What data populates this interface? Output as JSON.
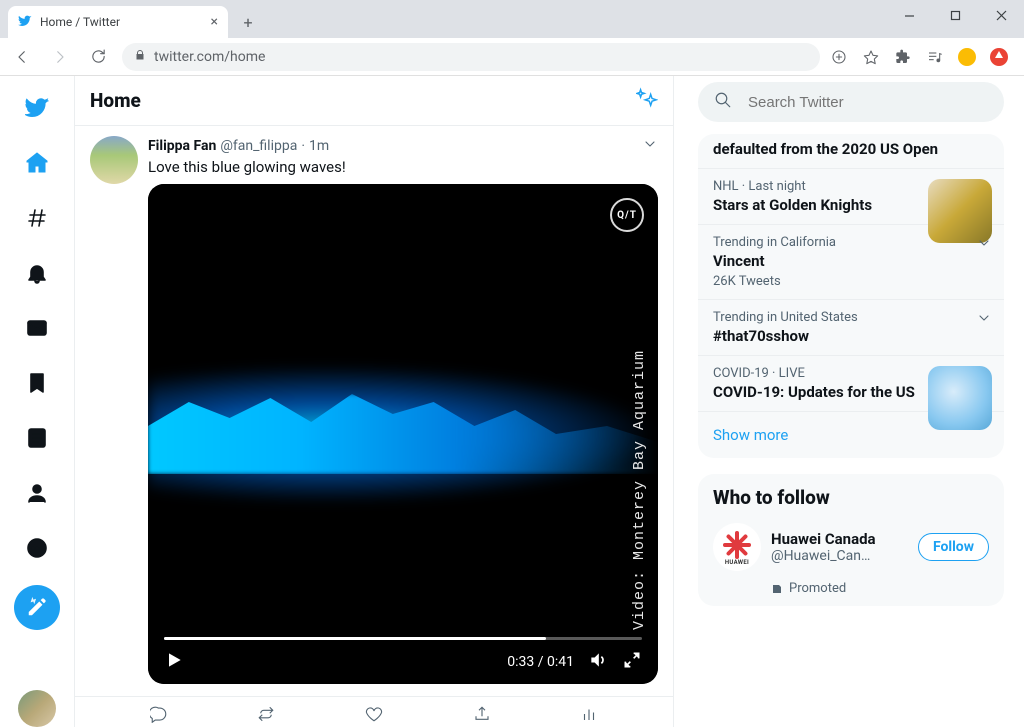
{
  "browser": {
    "tab_title": "Home / Twitter",
    "url": "twitter.com/home"
  },
  "header": {
    "title": "Home"
  },
  "search": {
    "placeholder": "Search Twitter"
  },
  "tweet": {
    "author_name": "Filippa Fan",
    "author_handle": "@fan_filippa",
    "separator": "·",
    "time": "1m",
    "text": "Love this blue glowing waves!",
    "video": {
      "badge": "Q/T",
      "credit": "Video: Monterey Bay Aquarium",
      "current_time": "0:33",
      "duration": "0:41",
      "time_display": "0:33 / 0:41",
      "progress_pct": 80
    }
  },
  "trends": {
    "items": [
      {
        "meta": "",
        "title": "defaulted from the 2020 US Open",
        "has_chevron": false,
        "has_thumb": false
      },
      {
        "meta": "NHL · Last night",
        "title": "Stars at Golden Knights",
        "has_chevron": false,
        "has_thumb": true,
        "thumb_css": "linear-gradient(135deg,#e8dcc0 0%, #c8a838 50%, #887828 100%)"
      },
      {
        "meta": "Trending in California",
        "title": "Vincent",
        "sub": "26K Tweets",
        "has_chevron": true
      },
      {
        "meta": "Trending in United States",
        "title": "#that70sshow",
        "has_chevron": true
      },
      {
        "meta": "COVID-19 · LIVE",
        "title": "COVID-19: Updates for the US",
        "has_chevron": false,
        "has_thumb": true,
        "thumb_css": "radial-gradient(circle at 40% 40%, #d8ecfa 0%, #88c8f0 60%, #58a8d8 100%)"
      }
    ],
    "show_more": "Show more"
  },
  "wtf": {
    "title": "Who to follow",
    "account": {
      "name": "Huawei Canada",
      "handle": "@Huawei_Can…",
      "follow_label": "Follow",
      "brand_label": "HUAWEI",
      "promoted_label": "Promoted"
    }
  },
  "colors": {
    "accent": "#1DA1F2"
  }
}
